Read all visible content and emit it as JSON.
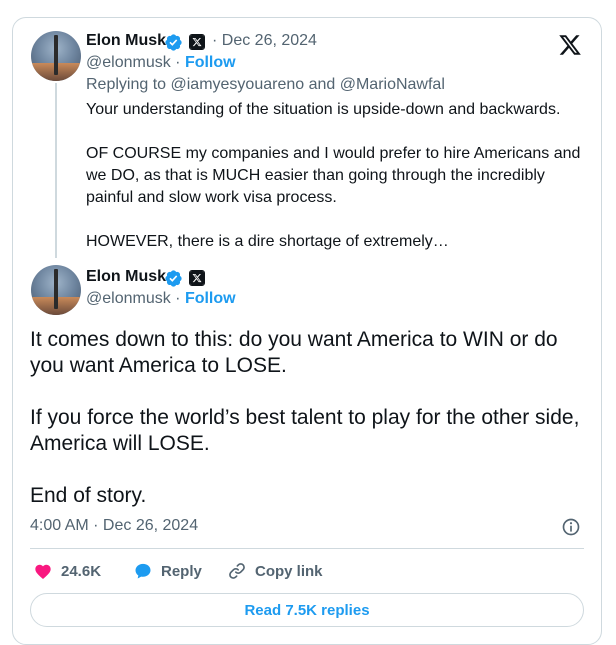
{
  "parent_post": {
    "author_name": "Elon Musk",
    "date": "· Dec 26, 2024",
    "handle": "@elonmusk",
    "separator": " · ",
    "follow_label": "Follow",
    "replying_to": "Replying to @iamyesyouareno and @MarioNawfal",
    "text": "Your understanding of the situation is upside-down and backwards.\n\nOF COURSE my companies and I would prefer to hire Americans and we DO, as that is MUCH easier than going through the incredibly painful and slow work visa process.\n\nHOWEVER, there is a dire shortage of extremely…"
  },
  "main_post": {
    "author_name": "Elon Musk",
    "handle": "@elonmusk",
    "separator": " · ",
    "follow_label": "Follow",
    "text": "It comes down to this: do you want America to WIN or do you want America to LOSE.\n\nIf you force the world’s best talent to play for the other side, America will LOSE.\n\nEnd of story.",
    "timestamp": "4:00 AM · Dec 26, 2024"
  },
  "actions": {
    "like_count": "24.6K",
    "reply_label": "Reply",
    "copy_link_label": "Copy link"
  },
  "read_replies_label": "Read 7.5K replies",
  "colors": {
    "accent": "#1d9bf0",
    "like": "#f91880",
    "text": "#0f1419",
    "muted": "#536471",
    "border": "#cfd9de"
  },
  "icons": [
    "verified-badge-icon",
    "x-affiliate-badge-icon",
    "x-logo-icon",
    "info-icon",
    "heart-icon",
    "reply-bubble-icon",
    "link-icon"
  ]
}
